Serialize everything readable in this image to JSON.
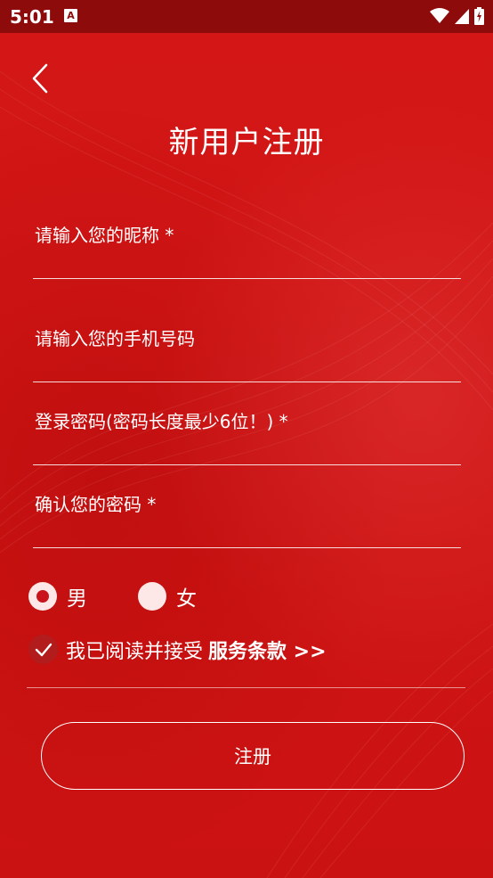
{
  "status_bar": {
    "time": "5:01",
    "notification_letter": "A"
  },
  "page": {
    "title": "新用户注册"
  },
  "form": {
    "nickname_placeholder": "请输入您的昵称 *",
    "phone_placeholder": "请输入您的手机号码",
    "password_placeholder": "登录密码(密码长度最少6位！) *",
    "confirm_placeholder": "确认您的密码 *"
  },
  "gender": {
    "male_label": "男",
    "female_label": "女",
    "selected": "男"
  },
  "agreement": {
    "checked": true,
    "text": "我已阅读并接受",
    "terms_link": "服务条款 >>"
  },
  "actions": {
    "register_label": "注册"
  },
  "colors": {
    "background": "#cf1414",
    "status_bar": "#8e0b0b",
    "radio_selected": "#c8141a"
  }
}
